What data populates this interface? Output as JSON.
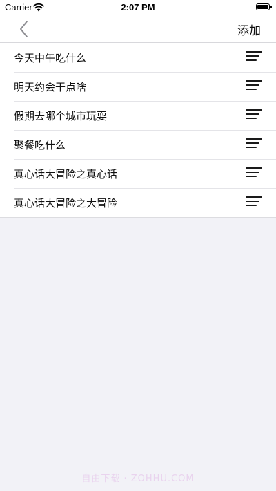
{
  "status_bar": {
    "carrier": "Carrier",
    "time": "2:07 PM",
    "wifi_icon": "wifi-icon",
    "battery_icon": "battery-icon",
    "battery_level": 1.0
  },
  "nav": {
    "back_icon": "chevron-left-icon",
    "add_label": "添加"
  },
  "items": [
    {
      "label": "今天中午吃什么"
    },
    {
      "label": "明天约会干点啥"
    },
    {
      "label": "假期去哪个城市玩耍"
    },
    {
      "label": "聚餐吃什么"
    },
    {
      "label": "真心话大冒险之真心话"
    },
    {
      "label": "真心话大冒险之大冒险"
    }
  ],
  "row_icon": "reorder-icon",
  "watermark": "自由下载 · ZOHHU.COM",
  "colors": {
    "background": "#f2f2f7",
    "surface": "#ffffff",
    "text": "#111111",
    "separator": "#e4e4e8",
    "watermark": "#e9d3ee"
  }
}
